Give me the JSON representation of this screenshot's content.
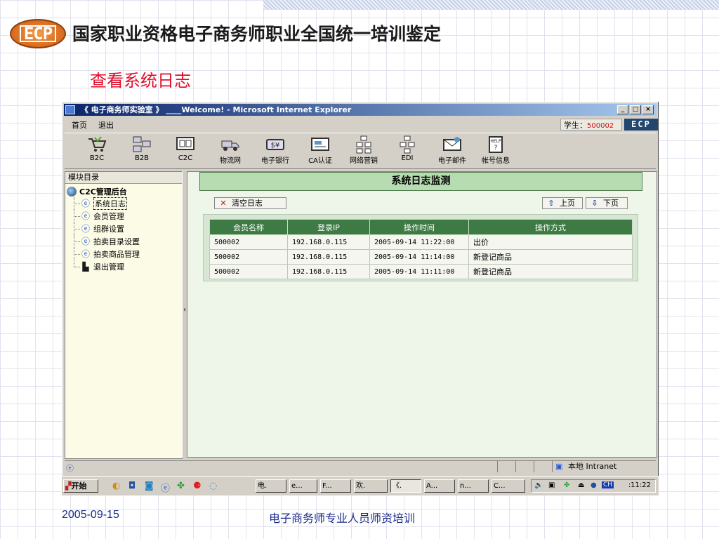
{
  "slide": {
    "logo_text": "ECP",
    "title": "国家职业资格电子商务师职业全国统一培训鉴定",
    "subtitle": "查看系统日志",
    "footer_date": "2005-09-15",
    "footer_text": "电子商务师专业人员师资培训"
  },
  "window": {
    "title": "《 电子商务师实验室 》 ____Welcome! - Microsoft Internet Explorer",
    "controls": [
      "_",
      "□",
      "×"
    ]
  },
  "menu": {
    "home": "首页",
    "logout": "退出",
    "student_label": "学生：",
    "student_id": "500002",
    "brand": "ECP"
  },
  "toolbar": {
    "items": [
      {
        "label": "B2C",
        "icon": "shopping-cart-icon"
      },
      {
        "label": "B2B",
        "icon": "network-computers-icon"
      },
      {
        "label": "C2C",
        "icon": "monitor-icon"
      },
      {
        "label": "物流网",
        "icon": "truck-icon"
      },
      {
        "label": "电子银行",
        "icon": "money-icon"
      },
      {
        "label": "CA认证",
        "icon": "certificate-icon"
      },
      {
        "label": "网络营销",
        "icon": "hierarchy-icon"
      },
      {
        "label": "EDI",
        "icon": "edi-icon"
      },
      {
        "label": "电子邮件",
        "icon": "email-icon"
      },
      {
        "label": "帐号信息",
        "icon": "help-icon"
      }
    ]
  },
  "sidebar": {
    "header": "模块目录",
    "root": "C2C管理后台",
    "items": [
      {
        "label": "系统日志",
        "icon": "ie-page-icon"
      },
      {
        "label": "会员管理",
        "icon": "ie-page-icon"
      },
      {
        "label": "组群设置",
        "icon": "ie-page-icon"
      },
      {
        "label": "拍卖目录设置",
        "icon": "ie-page-icon"
      },
      {
        "label": "拍卖商品管理",
        "icon": "ie-page-icon"
      },
      {
        "label": "退出管理",
        "icon": "exit-icon"
      }
    ]
  },
  "main": {
    "panel_title": "系统日志监测",
    "clear_button": "清空日志",
    "prev_button": "上页",
    "next_button": "下页",
    "table": {
      "headers": [
        "会员名称",
        "登录IP",
        "操作时间",
        "操作方式"
      ],
      "rows": [
        [
          "500002",
          "192.168.0.115",
          "2005-09-14 11:22:00",
          "出价"
        ],
        [
          "500002",
          "192.168.0.115",
          "2005-09-14 11:14:00",
          "新登记商品"
        ],
        [
          "500002",
          "192.168.0.115",
          "2005-09-14 11:11:00",
          "新登记商品"
        ]
      ]
    }
  },
  "statusbar": {
    "zone": "本地 Intranet"
  },
  "taskbar": {
    "start": "开始",
    "buttons": [
      "电.",
      "e...",
      "F...",
      "欢.",
      "《.",
      "A...",
      "n...",
      "C..."
    ],
    "lang": "CH",
    "clock": ":11:22"
  }
}
